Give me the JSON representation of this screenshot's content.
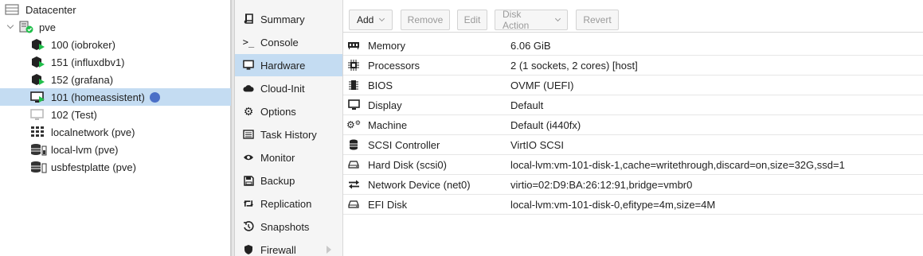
{
  "tree": {
    "items": [
      {
        "label": "Datacenter"
      },
      {
        "label": "pve"
      },
      {
        "label": "100 (iobroker)"
      },
      {
        "label": "151 (influxdbv1)"
      },
      {
        "label": "152 (grafana)"
      },
      {
        "label": "101 (homeassistent)"
      },
      {
        "label": "102 (Test)"
      },
      {
        "label": "localnetwork (pve)"
      },
      {
        "label": "local-lvm (pve)"
      },
      {
        "label": "usbfestplatte (pve)"
      }
    ]
  },
  "nav": {
    "items": [
      {
        "label": "Summary",
        "icon": "book-icon"
      },
      {
        "label": "Console",
        "icon": "terminal-icon"
      },
      {
        "label": "Hardware",
        "icon": "monitor-icon"
      },
      {
        "label": "Cloud-Init",
        "icon": "cloud-icon"
      },
      {
        "label": "Options",
        "icon": "gear-icon"
      },
      {
        "label": "Task History",
        "icon": "list-icon"
      },
      {
        "label": "Monitor",
        "icon": "eye-icon"
      },
      {
        "label": "Backup",
        "icon": "floppy-icon"
      },
      {
        "label": "Replication",
        "icon": "retweet-icon"
      },
      {
        "label": "Snapshots",
        "icon": "history-icon"
      },
      {
        "label": "Firewall",
        "icon": "shield-icon"
      }
    ]
  },
  "toolbar": {
    "add": "Add",
    "remove": "Remove",
    "edit": "Edit",
    "disk_action": "Disk Action",
    "revert": "Revert"
  },
  "hardware": {
    "rows": [
      {
        "label": "Memory",
        "value": "6.06 GiB",
        "icon": "memory-icon"
      },
      {
        "label": "Processors",
        "value": "2 (1 sockets, 2 cores) [host]",
        "icon": "cpu-icon"
      },
      {
        "label": "BIOS",
        "value": "OVMF (UEFI)",
        "icon": "microchip-icon"
      },
      {
        "label": "Display",
        "value": "Default",
        "icon": "desktop-icon"
      },
      {
        "label": "Machine",
        "value": "Default (i440fx)",
        "icon": "cogs-icon"
      },
      {
        "label": "SCSI Controller",
        "value": "VirtIO SCSI",
        "icon": "database-icon"
      },
      {
        "label": "Hard Disk (scsi0)",
        "value": "local-lvm:vm-101-disk-1,cache=writethrough,discard=on,size=32G,ssd=1",
        "icon": "hdd-icon"
      },
      {
        "label": "Network Device (net0)",
        "value": "virtio=02:D9:BA:26:12:91,bridge=vmbr0",
        "icon": "exchange-icon"
      },
      {
        "label": "EFI Disk",
        "value": "local-lvm:vm-101-disk-0,efitype=4m,size=4M",
        "icon": "hdd-icon"
      }
    ]
  },
  "colors": {
    "selected": "#c4dcf2",
    "running": "#21bf4b",
    "status_dot": "#4a6fc7"
  }
}
